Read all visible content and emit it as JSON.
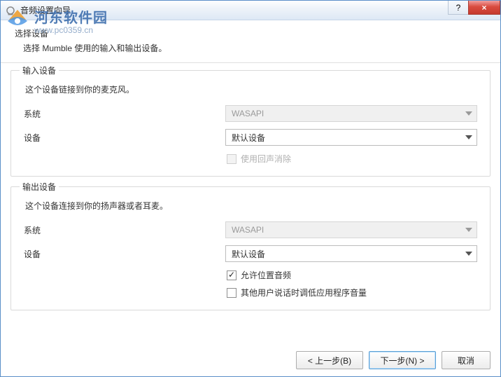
{
  "window": {
    "title": "音频设置向导",
    "help_tooltip": "?",
    "close_tooltip": "×"
  },
  "watermark": {
    "line1": "河东软件园",
    "line2": "www.pc0359.cn"
  },
  "header": {
    "title": "选择设备",
    "subtitle": "选择 Mumble 使用的输入和输出设备。"
  },
  "input": {
    "legend": "输入设备",
    "desc": "这个设备链接到你的麦克风。",
    "system_label": "系统",
    "system_value": "WASAPI",
    "device_label": "设备",
    "device_value": "默认设备",
    "echo_label": "使用回声消除"
  },
  "output": {
    "legend": "输出设备",
    "desc": "这个设备连接到你的扬声器或者耳麦。",
    "system_label": "系统",
    "system_value": "WASAPI",
    "device_label": "设备",
    "device_value": "默认设备",
    "positional_label": "允许位置音频",
    "attenuate_label": "其他用户说话时调低应用程序音量"
  },
  "footer": {
    "back": "< 上一步(B)",
    "next": "下一步(N) >",
    "cancel": "取消"
  }
}
